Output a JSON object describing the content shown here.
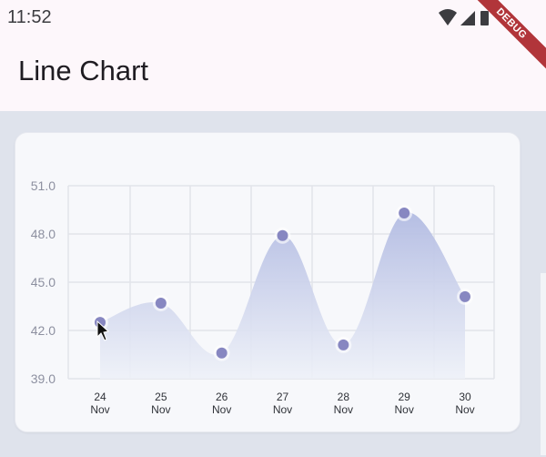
{
  "status_bar": {
    "time": "11:52"
  },
  "app_bar": {
    "title": "Line Chart"
  },
  "debug_banner": {
    "label": "DEBUG"
  },
  "chart_data": {
    "type": "line",
    "categories": [
      [
        "24",
        "Nov"
      ],
      [
        "25",
        "Nov"
      ],
      [
        "26",
        "Nov"
      ],
      [
        "27",
        "Nov"
      ],
      [
        "28",
        "Nov"
      ],
      [
        "29",
        "Nov"
      ],
      [
        "30",
        "Nov"
      ]
    ],
    "values": [
      42.5,
      43.7,
      40.6,
      47.9,
      41.1,
      49.3,
      44.1
    ],
    "ylim": [
      39.0,
      51.0
    ],
    "yticks": [
      "51.0",
      "48.0",
      "45.0",
      "42.0",
      "39.0"
    ],
    "grid": true,
    "colors": {
      "line_fill_top": "#b6bfe3",
      "line_fill_bottom": "#eef1f8",
      "point": "#8787c1",
      "grid": "#e2e4ea"
    }
  }
}
